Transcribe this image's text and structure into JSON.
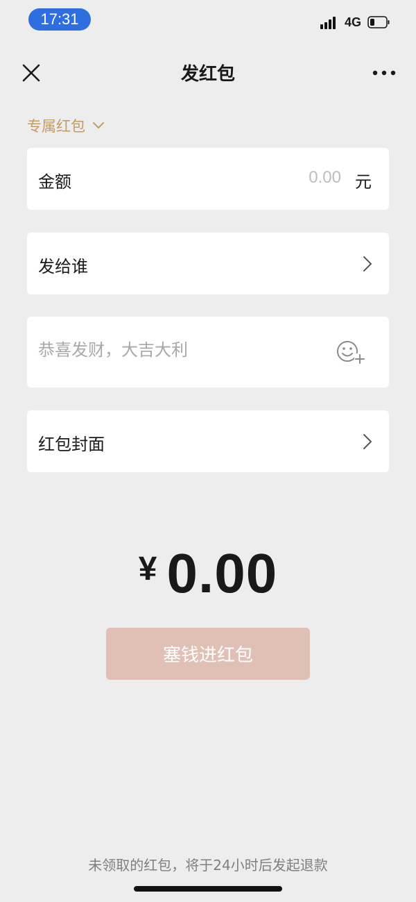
{
  "status_bar": {
    "time": "17:31",
    "network": "4G"
  },
  "nav": {
    "title": "发红包",
    "close_icon": "close-icon",
    "more_icon": "more-dots-icon"
  },
  "type_selector": {
    "label": "专属红包",
    "icon": "chevron-down-icon",
    "color": "#c29b63"
  },
  "amount_field": {
    "label": "金额",
    "placeholder": "0.00",
    "unit": "元"
  },
  "recipient_field": {
    "label": "发给谁",
    "icon": "chevron-right-icon"
  },
  "message_field": {
    "placeholder": "恭喜发财，大吉大利",
    "icon": "emoji-add-icon"
  },
  "cover_field": {
    "label": "红包封面",
    "icon": "chevron-right-icon"
  },
  "total": {
    "currency": "¥",
    "amount": "0.00"
  },
  "submit_button": {
    "label": "塞钱进红包",
    "color": "#e0bfb5"
  },
  "footer": {
    "note": "未领取的红包，将于24小时后发起退款"
  },
  "colors": {
    "background": "#ededed",
    "card": "#ffffff",
    "accent_gold": "#c29b63",
    "time_pill": "#2f6ee0"
  }
}
